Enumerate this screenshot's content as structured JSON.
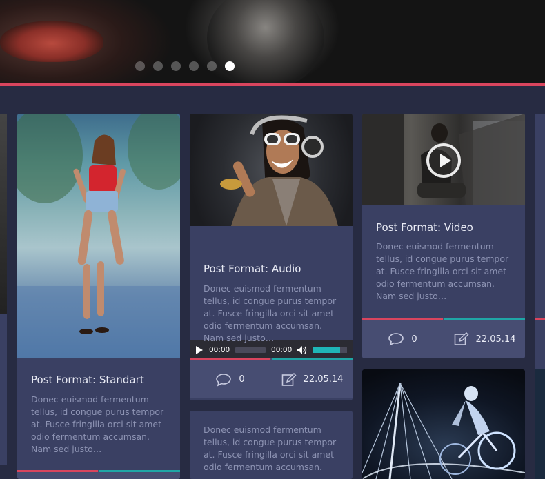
{
  "slider": {
    "dots": 6,
    "active_index": 5
  },
  "colors": {
    "accent_red": "#d9455e",
    "accent_teal": "#1fa6a6",
    "card_bg": "#3a4063",
    "meta_bg": "#474d72",
    "page_bg": "#272b42"
  },
  "cards": {
    "standard": {
      "title": "Post Format: Standart",
      "excerpt": [
        "Donec euismod fermentum",
        "tellus, id congue purus tempor",
        "at. Fusce fringilla orci sit amet",
        "odio fermentum accumsan.",
        "Nam sed justo…"
      ]
    },
    "audio": {
      "title": "Post Format: Audio",
      "player": {
        "current_time": "00:00",
        "duration": "00:00",
        "volume": 0.8
      },
      "excerpt": [
        "Donec euismod fermentum",
        "tellus, id congue purus tempor",
        "at. Fusce fringilla orci sit amet",
        "odio fermentum accumsan.",
        "Nam sed justo…"
      ],
      "comments": "0",
      "date": "22.05.14"
    },
    "audio_next": {
      "excerpt": [
        "Donec euismod fermentum",
        "tellus, id congue purus tempor",
        "at. Fusce fringilla orci sit amet",
        "odio fermentum accumsan."
      ]
    },
    "video": {
      "title": "Post Format: Video",
      "excerpt": [
        "Donec euismod fermentum",
        "tellus, id congue purus tempor",
        "at. Fusce fringilla orci sit amet",
        "odio fermentum accumsan.",
        "Nam sed justo…"
      ],
      "comments": "0",
      "date": "22.05.14"
    }
  },
  "icons": {
    "comment": "speech-bubble-icon",
    "date": "edit-icon",
    "play": "play-icon",
    "volume": "volume-icon"
  }
}
